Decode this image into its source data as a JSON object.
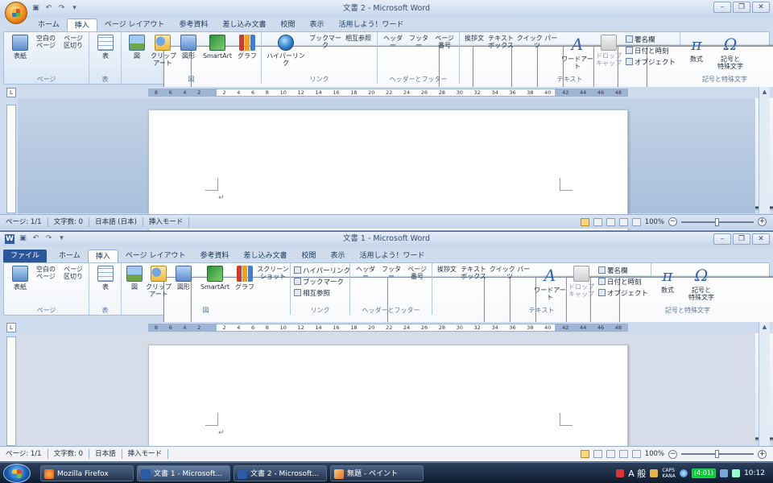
{
  "window1": {
    "title": "文書 2 - Microsoft Word",
    "tabs": [
      "ホーム",
      "挿入",
      "ページ レイアウト",
      "参考資料",
      "差し込み文書",
      "校閲",
      "表示",
      "活用しよう！ワード"
    ],
    "active_tab": "挿入",
    "groups": {
      "page": {
        "label": "ページ",
        "cover": "表紙",
        "blank": "空白の\nページ",
        "break": "ページ\n区切り"
      },
      "table": {
        "label": "表",
        "table": "表"
      },
      "illustrations": {
        "label": "図",
        "picture": "図",
        "clipart": "クリップ\nアート",
        "shapes": "図形",
        "smartart": "SmartArt",
        "chart": "グラフ"
      },
      "links": {
        "label": "リンク",
        "hyperlink": "ハイパーリンク",
        "bookmark": "ブックマーク",
        "crossref": "相互参照"
      },
      "header_footer": {
        "label": "ヘッダーとフッター",
        "header": "ヘッダー",
        "footer": "フッター",
        "pagenum": "ページ\n番号"
      },
      "text": {
        "label": "テキスト",
        "greeting": "挨拶文",
        "textbox": "テキスト\nボックス",
        "quickparts": "クイック パーツ",
        "wordart": "ワードアート",
        "dropcap": "ドロップ\nキャップ",
        "signature": "署名欄",
        "datetime": "日付と時刻",
        "object": "オブジェクト"
      },
      "symbols": {
        "label": "記号と特殊文字",
        "equation": "数式",
        "symbol": "記号と\n特殊文字"
      }
    },
    "ruler_numbers": [
      "8",
      "6",
      "4",
      "2",
      "",
      "2",
      "4",
      "6",
      "8",
      "10",
      "12",
      "14",
      "16",
      "18",
      "20",
      "22",
      "24",
      "26",
      "28",
      "30",
      "32",
      "34",
      "36",
      "38",
      "40",
      "42",
      "44",
      "46",
      "48"
    ],
    "status": {
      "page": "ページ: 1/1",
      "words": "文字数: 0",
      "lang": "日本語 (日本)",
      "mode": "挿入モード",
      "zoom": "100%"
    }
  },
  "window2": {
    "title": "文書 1 - Microsoft Word",
    "tabs": [
      "ファイル",
      "ホーム",
      "挿入",
      "ページ レイアウト",
      "参考資料",
      "差し込み文書",
      "校閲",
      "表示",
      "活用しよう！ワード"
    ],
    "active_tab": "挿入",
    "groups": {
      "page": {
        "label": "ページ",
        "cover": "表紙",
        "blank": "空白の\nページ",
        "break": "ページ\n区切り"
      },
      "table": {
        "label": "表",
        "table": "表"
      },
      "illustrations": {
        "label": "図",
        "picture": "図",
        "clipart": "クリップ\nアート",
        "shapes": "図形",
        "smartart": "SmartArt",
        "chart": "グラフ",
        "screenshot": "スクリーン\nショット"
      },
      "links": {
        "label": "リンク",
        "hyperlink": "ハイパーリンク",
        "bookmark": "ブックマーク",
        "crossref": "相互参照"
      },
      "header_footer": {
        "label": "ヘッダーとフッター",
        "header": "ヘッダー",
        "footer": "フッター",
        "pagenum": "ページ\n番号"
      },
      "text": {
        "label": "テキスト",
        "greeting": "挨拶文",
        "textbox": "テキスト\nボックス",
        "quickparts": "クイック パーツ",
        "wordart": "ワードアート",
        "dropcap": "ドロップ\nキャップ",
        "signature": "署名欄",
        "datetime": "日付と時刻",
        "object": "オブジェクト"
      },
      "symbols": {
        "label": "記号と特殊文字",
        "equation": "数式",
        "symbol": "記号と\n特殊文字"
      }
    },
    "status": {
      "page": "ページ: 1/1",
      "words": "文字数: 0",
      "lang": "日本語",
      "mode": "挿入モード",
      "zoom": "100%"
    }
  },
  "taskbar": {
    "items": [
      "Mozilla Firefox",
      "文書 1 - Microsoft...",
      "文書 2 - Microsoft...",
      "無題 - ペイント"
    ],
    "ime": "A 般",
    "caps": "CAPS\nKANA",
    "battery": "(4:01)",
    "clock": "10:12"
  },
  "colors": {
    "accent": "#2b579a",
    "ribbon_bg": "#dbe7f5",
    "taskbar": "#1b2c45"
  }
}
